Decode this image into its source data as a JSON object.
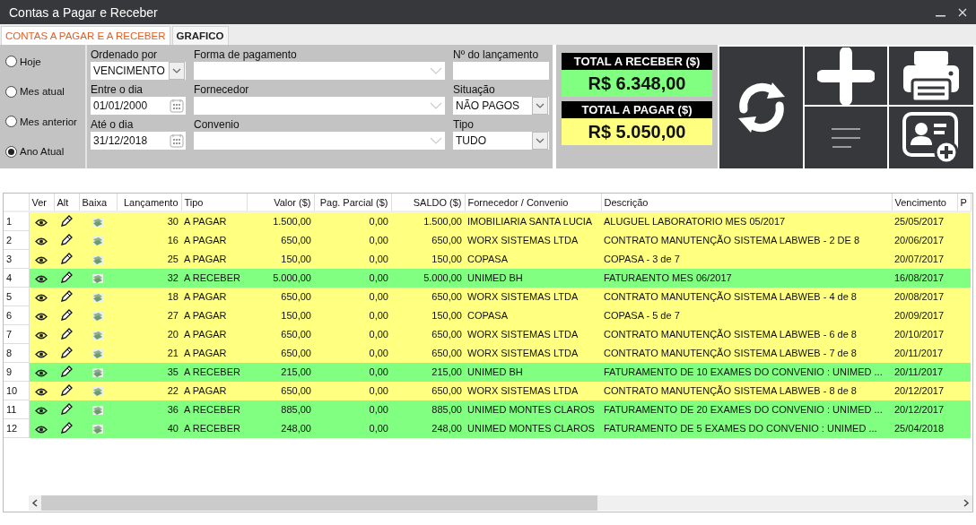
{
  "window": {
    "title": "Contas a Pagar e Receber"
  },
  "tabs": [
    {
      "label": "CONTAS A PAGAR E A RECEBER",
      "selected": true
    },
    {
      "label": "GRAFICO",
      "selected": false
    }
  ],
  "period_options": [
    {
      "label": "Hoje",
      "selected": false
    },
    {
      "label": "Mes atual",
      "selected": false
    },
    {
      "label": "Mes anterior",
      "selected": false
    },
    {
      "label": "Ano Atual",
      "selected": true
    }
  ],
  "fields": [
    {
      "kind": "select",
      "label": "Ordenado por",
      "value": "VENCIMENTO"
    },
    {
      "kind": "combo",
      "label": "Forma de pagamento"
    },
    {
      "kind": "text",
      "label": "Nº do lançamento"
    },
    {
      "kind": "date",
      "label": "Entre o dia",
      "value": "01/01/2000"
    },
    {
      "kind": "combo",
      "label": "Fornecedor"
    },
    {
      "kind": "select",
      "label": "Situação",
      "value": "NÃO PAGOS"
    },
    {
      "kind": "date",
      "label": "Até o dia",
      "value": "31/12/2018"
    },
    {
      "kind": "combo",
      "label": "Convenio"
    },
    {
      "kind": "select",
      "label": "Tipo",
      "value": "TUDO"
    }
  ],
  "totals": [
    {
      "kind": "receber",
      "label": "TOTAL A RECEBER ($)",
      "value": "R$ 6.348,00"
    },
    {
      "kind": "pagar",
      "label": "TOTAL A PAGAR ($)",
      "value": "R$ 5.050,00"
    }
  ],
  "table": {
    "icon_columns": [
      "Ver",
      "Alt",
      "Baixa"
    ],
    "columns": [
      "Lançamento",
      "Tipo",
      "Valor ($)",
      "Pag. Parcial ($)",
      "SALDO ($)",
      "Fornecedor / Convenio",
      "Descrição",
      "Vencimento",
      "P"
    ],
    "rows": [
      {
        "kind": "pagar",
        "number": "1",
        "cells": [
          "30",
          "A PAGAR",
          "1.500,00",
          "0,00",
          "1.500,00",
          "IMOBILIARIA SANTA LUCIA",
          "ALUGUEL LABORATORIO MES 05/2017",
          "25/05/2017"
        ]
      },
      {
        "kind": "pagar",
        "number": "2",
        "cells": [
          "16",
          "A PAGAR",
          "650,00",
          "0,00",
          "650,00",
          "WORX SISTEMAS LTDA",
          "CONTRATO MANUTENÇÃO SISTEMA LABWEB - 2 DE 8",
          "20/06/2017"
        ]
      },
      {
        "kind": "pagar",
        "number": "3",
        "cells": [
          "25",
          "A PAGAR",
          "150,00",
          "0,00",
          "150,00",
          "COPASA",
          "COPASA - 3 de 7",
          "20/07/2017"
        ]
      },
      {
        "kind": "receber",
        "number": "4",
        "cells": [
          "32",
          "A RECEBER",
          "5.000,00",
          "0,00",
          "5.000,00",
          "UNIMED BH",
          "FATURAENTO MES 06/2017",
          "16/08/2017"
        ]
      },
      {
        "kind": "pagar",
        "number": "5",
        "cells": [
          "18",
          "A PAGAR",
          "650,00",
          "0,00",
          "650,00",
          "WORX SISTEMAS LTDA",
          "CONTRATO MANUTENÇÃO SISTEMA LABWEB - 4 de 8",
          "20/08/2017"
        ]
      },
      {
        "kind": "pagar",
        "number": "6",
        "cells": [
          "27",
          "A PAGAR",
          "150,00",
          "0,00",
          "150,00",
          "COPASA",
          "COPASA - 5 de 7",
          "20/09/2017"
        ]
      },
      {
        "kind": "pagar",
        "number": "7",
        "cells": [
          "20",
          "A PAGAR",
          "650,00",
          "0,00",
          "650,00",
          "WORX SISTEMAS LTDA",
          "CONTRATO MANUTENÇÃO SISTEMA LABWEB - 6 de 8",
          "20/10/2017"
        ]
      },
      {
        "kind": "pagar",
        "number": "8",
        "cells": [
          "21",
          "A PAGAR",
          "650,00",
          "0,00",
          "650,00",
          "WORX SISTEMAS LTDA",
          "CONTRATO MANUTENÇÃO SISTEMA LABWEB - 7 de 8",
          "20/11/2017"
        ]
      },
      {
        "kind": "receber",
        "number": "9",
        "cells": [
          "35",
          "A RECEBER",
          "215,00",
          "0,00",
          "215,00",
          "UNIMED BH",
          "FATURAMENTO DE 10 EXAMES DO CONVENIO : UNIMED ...",
          "20/11/2017"
        ]
      },
      {
        "kind": "pagar",
        "number": "10",
        "cells": [
          "22",
          "A PAGAR",
          "650,00",
          "0,00",
          "650,00",
          "WORX SISTEMAS LTDA",
          "CONTRATO MANUTENÇÃO SISTEMA LABWEB - 8 de 8",
          "20/12/2017"
        ]
      },
      {
        "kind": "receber",
        "number": "11",
        "cells": [
          "36",
          "A RECEBER",
          "885,00",
          "0,00",
          "885,00",
          "UNIMED MONTES CLAROS",
          "FATURAMENTO DE 20 EXAMES DO CONVENIO : UNIMED ...",
          "20/12/2017"
        ]
      },
      {
        "kind": "receber",
        "number": "12",
        "cells": [
          "40",
          "A RECEBER",
          "248,00",
          "0,00",
          "248,00",
          "UNIMED MONTES CLAROS",
          "FATURAMENTO DE 5 EXAMES DO CONVENIO : UNIMED ...",
          "25/04/2018"
        ]
      }
    ]
  }
}
